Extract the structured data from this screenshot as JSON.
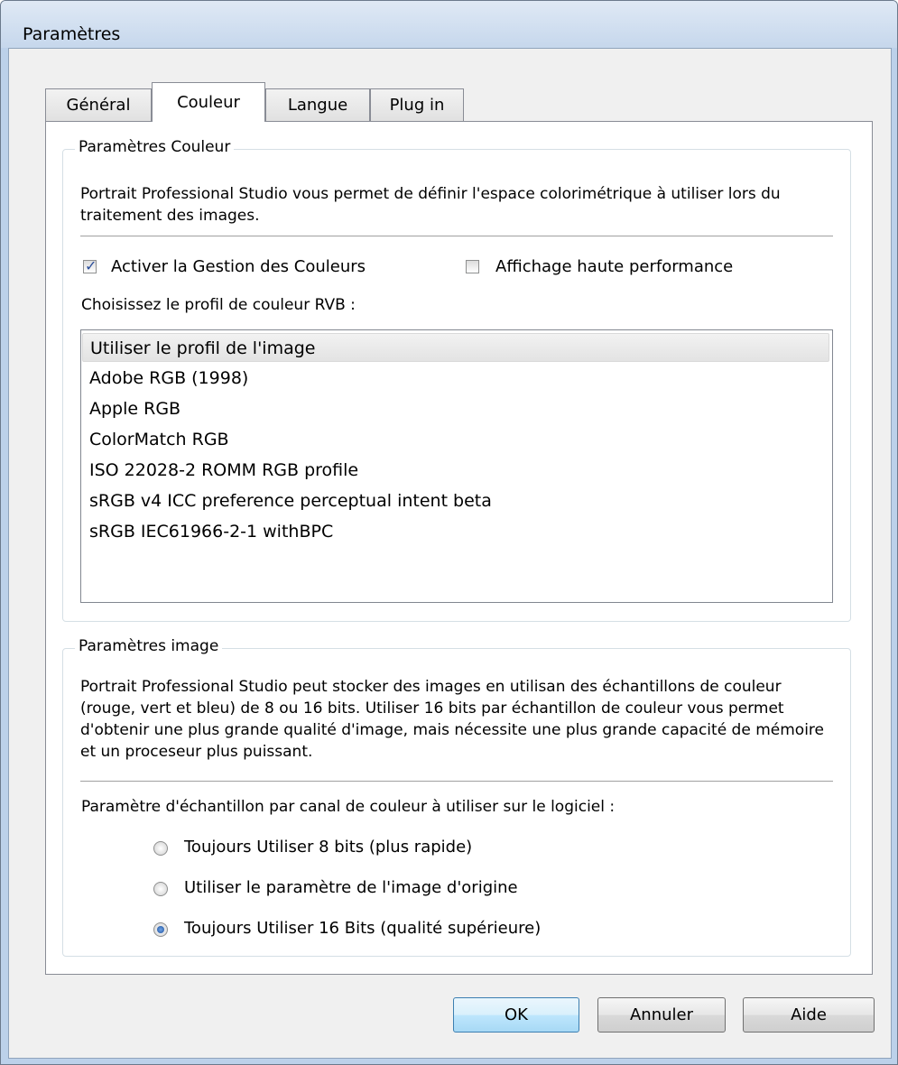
{
  "window": {
    "title": "Paramètres"
  },
  "tabs": [
    {
      "label": "Général"
    },
    {
      "label": "Couleur"
    },
    {
      "label": "Langue"
    },
    {
      "label": "Plug in"
    }
  ],
  "color_settings": {
    "legend": "Paramètres Couleur",
    "description": "Portrait Professional Studio vous permet de définir l'espace colorimétrique à utiliser lors du traitement des images.",
    "enable_color_mgmt": {
      "label": "Activer la Gestion des Couleurs",
      "checked": true
    },
    "high_perf_display": {
      "label": "Affichage haute performance",
      "checked": false
    },
    "profile_prompt": "Choisissez le profil de couleur RVB :",
    "profiles": [
      "Utiliser le profil de l'image",
      "Adobe RGB (1998)",
      "Apple RGB",
      "ColorMatch RGB",
      "ISO 22028-2 ROMM RGB profile",
      "sRGB v4 ICC preference perceptual intent beta",
      "sRGB IEC61966-2-1 withBPC"
    ],
    "selected_profile": "Utiliser le profil de l'image"
  },
  "image_settings": {
    "legend": "Paramètres image",
    "description": "Portrait Professional Studio peut stocker des images en utilisan des échantillons de couleur (rouge, vert et bleu) de 8 ou 16 bits.  Utiliser 16 bits par échantillon de couleur vous permet d'obtenir une plus grande qualité d'image, mais nécessite une plus grande capacité de mémoire et un proceseur plus puissant.",
    "bits_prompt": "Paramètre d'échantillon par canal de couleur à utiliser sur le logiciel :",
    "options": [
      {
        "label": "Toujours Utiliser 8 bits (plus rapide)",
        "selected": false
      },
      {
        "label": "Utiliser le paramètre de l'image d'origine",
        "selected": false
      },
      {
        "label": "Toujours Utiliser 16 Bits (qualité supérieure)",
        "selected": true
      }
    ]
  },
  "buttons": {
    "ok": "OK",
    "cancel": "Annuler",
    "help": "Aide"
  }
}
